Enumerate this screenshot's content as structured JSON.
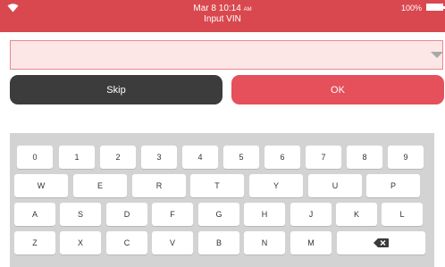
{
  "status": {
    "date_time": "Mar 8 10:14",
    "ampm": "AM",
    "battery": "100%"
  },
  "header": {
    "title": "Input VIN"
  },
  "vin": {
    "value": "",
    "placeholder": ""
  },
  "buttons": {
    "skip": "Skip",
    "ok": "OK"
  },
  "keyboard": {
    "row1": [
      "0",
      "1",
      "2",
      "3",
      "4",
      "5",
      "6",
      "7",
      "8",
      "9"
    ],
    "row2": [
      "W",
      "E",
      "R",
      "T",
      "Y",
      "U",
      "P"
    ],
    "row3": [
      "A",
      "S",
      "D",
      "F",
      "G",
      "H",
      "J",
      "K",
      "L"
    ],
    "row4": [
      "Z",
      "X",
      "C",
      "V",
      "B",
      "N",
      "M"
    ]
  },
  "icons": {
    "wifi": "wifi-icon",
    "battery": "battery-icon",
    "dropdown": "chevron-down-icon",
    "backspace": "backspace-icon"
  },
  "colors": {
    "header": "#d9484f",
    "ok": "#e5505a",
    "skip": "#3c3c3c",
    "input_bg": "#fde6e6"
  }
}
